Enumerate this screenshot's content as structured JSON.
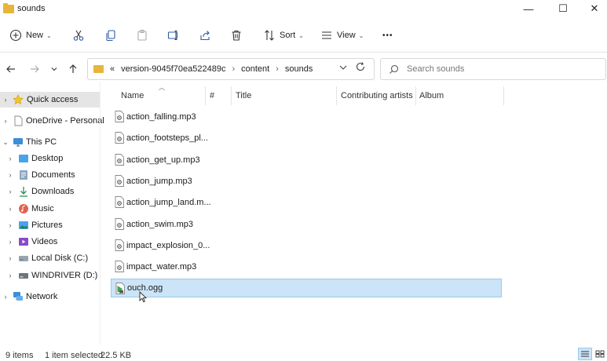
{
  "window": {
    "title": "sounds",
    "minimize_glyph": "—",
    "maximize_glyph": "☐",
    "close_glyph": "✕"
  },
  "toolbar": {
    "new_label": "New",
    "sort_label": "Sort",
    "view_label": "View",
    "more_glyph": "•••",
    "icons": [
      "plus-icon",
      "cut-icon",
      "copy-icon",
      "paste-icon",
      "rename-icon",
      "share-icon",
      "delete-icon",
      "sort-icon",
      "view-icon",
      "more-icon"
    ]
  },
  "address": {
    "overflow": "«",
    "crumbs": [
      "version-9045f70ea522489c",
      "content",
      "sounds"
    ],
    "separator": "›"
  },
  "search": {
    "placeholder": "Search sounds"
  },
  "sidebar": {
    "items": [
      {
        "label": "Quick access",
        "icon": "star-icon"
      },
      {
        "label": "OneDrive - Personal",
        "icon": "document-icon"
      },
      {
        "label": "This PC",
        "icon": "monitor-icon"
      },
      {
        "label": "Desktop",
        "icon": "desktop-icon"
      },
      {
        "label": "Documents",
        "icon": "documents-icon"
      },
      {
        "label": "Downloads",
        "icon": "download-icon"
      },
      {
        "label": "Music",
        "icon": "music-icon"
      },
      {
        "label": "Pictures",
        "icon": "pictures-icon"
      },
      {
        "label": "Videos",
        "icon": "videos-icon"
      },
      {
        "label": "Local Disk (C:)",
        "icon": "drive-icon"
      },
      {
        "label": "WINDRIVER (D:)",
        "icon": "drive-icon"
      },
      {
        "label": "Network",
        "icon": "network-icon"
      }
    ]
  },
  "columns": {
    "name": "Name",
    "number": "#",
    "title": "Title",
    "artists": "Contributing artists",
    "album": "Album"
  },
  "files": [
    {
      "name": "action_falling.mp3"
    },
    {
      "name": "action_footsteps_pl..."
    },
    {
      "name": "action_get_up.mp3"
    },
    {
      "name": "action_jump.mp3"
    },
    {
      "name": "action_jump_land.m..."
    },
    {
      "name": "action_swim.mp3"
    },
    {
      "name": "impact_explosion_0..."
    },
    {
      "name": "impact_water.mp3"
    },
    {
      "name": "ouch.ogg"
    }
  ],
  "status": {
    "item_count": "9 items",
    "selection": "1 item selected",
    "size": "22.5 KB"
  },
  "colors": {
    "folder": "#e8b53a",
    "selection": "#cce4f7",
    "selection_border": "#99c9ef",
    "accent": "#0067c0"
  }
}
